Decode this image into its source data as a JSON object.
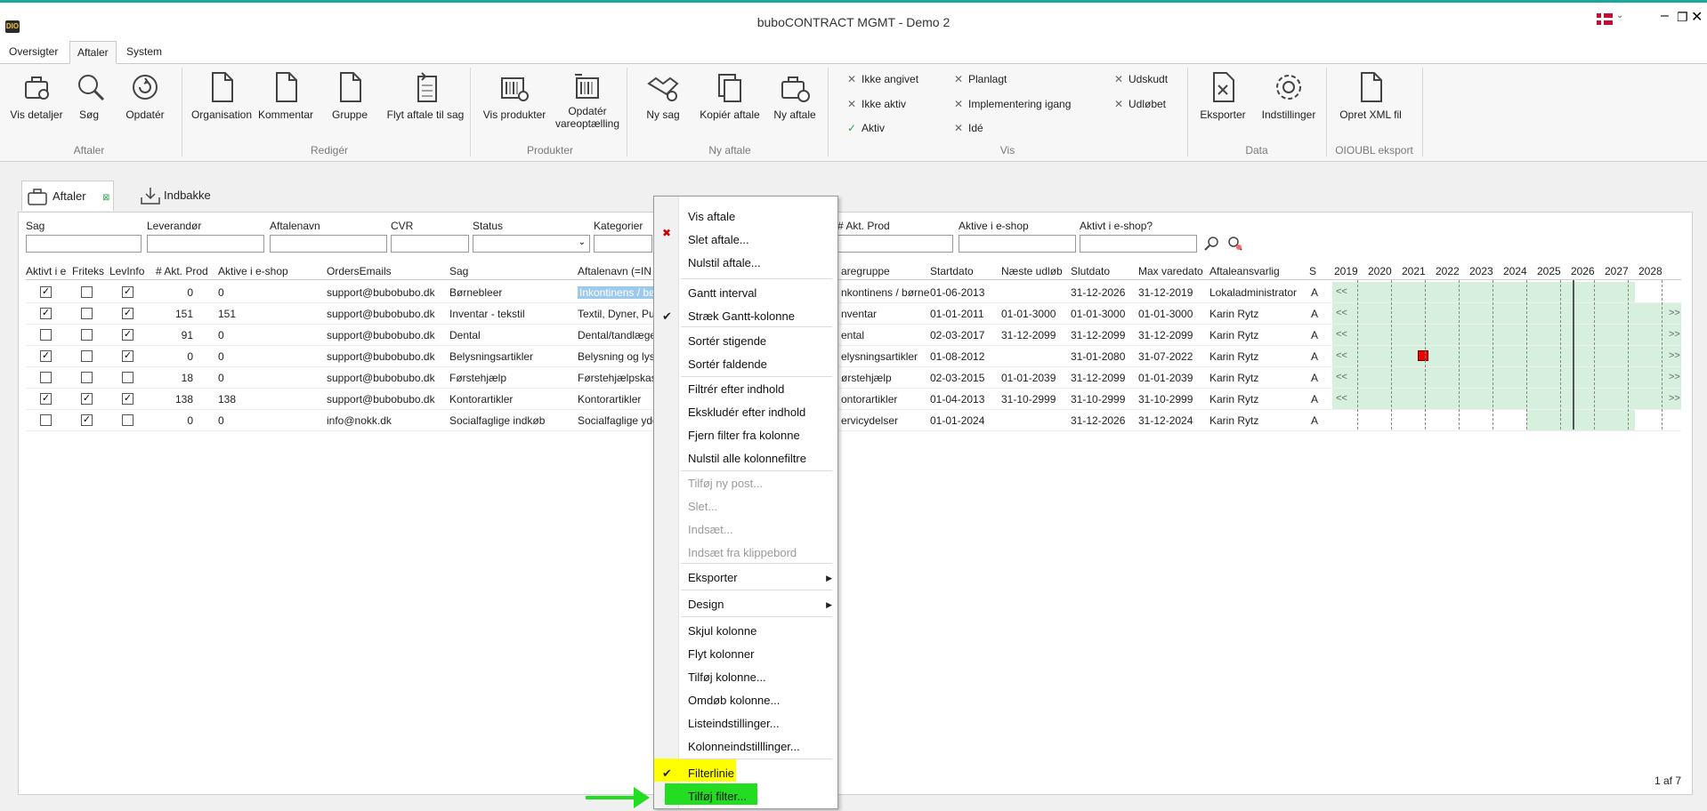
{
  "app": {
    "title": "buboCONTRACT MGMT - Demo 2",
    "logo": "DIO"
  },
  "menu_tabs": [
    "Oversigter",
    "Aftaler",
    "System"
  ],
  "ribbon": {
    "buttons": [
      {
        "label": "Vis detaljer",
        "icon": "briefcase-search-icon"
      },
      {
        "label": "Søg",
        "icon": "magnifier-icon"
      },
      {
        "label": "Opdatér",
        "icon": "refresh-icon"
      },
      {
        "label": "Organisation",
        "icon": "document-icon"
      },
      {
        "label": "Kommentar",
        "icon": "document-icon"
      },
      {
        "label": "Gruppe",
        "icon": "document-icon"
      },
      {
        "label": "Flyt aftale til sag",
        "icon": "move-document-icon"
      },
      {
        "label": "Vis produkter",
        "icon": "barcode-icon"
      },
      {
        "label": "Opdatér vareoptælling",
        "icon": "barcode-refresh-icon"
      },
      {
        "label": "Ny sag",
        "icon": "handshake-icon"
      },
      {
        "label": "Kopiér aftale",
        "icon": "copy-icon"
      },
      {
        "label": "Ny aftale",
        "icon": "briefcase-add-icon"
      },
      {
        "label": "Eksporter",
        "icon": "excel-export-icon"
      },
      {
        "label": "Indstillinger",
        "icon": "gear-icon"
      },
      {
        "label": "Opret XML fil",
        "icon": "document-icon"
      }
    ],
    "groups": [
      "Aftaler",
      "Redigér",
      "Produkter",
      "Ny aftale",
      "Vis",
      "Data",
      "OIOUBL eksport"
    ],
    "vis_items": [
      {
        "label": "Ikke angivet",
        "checked": false
      },
      {
        "label": "Ikke aktiv",
        "checked": false
      },
      {
        "label": "Aktiv",
        "checked": true
      },
      {
        "label": "Planlagt",
        "checked": false
      },
      {
        "label": "Implementering igang",
        "checked": false
      },
      {
        "label": "Idé",
        "checked": false
      },
      {
        "label": "Udskudt",
        "checked": false
      },
      {
        "label": "Udløbet",
        "checked": false
      }
    ]
  },
  "doc_tabs": [
    "Aftaler",
    "Indbakke"
  ],
  "filters": {
    "labels": [
      "Sag",
      "Leverandør",
      "Aftalenavn",
      "CVR",
      "Status",
      "Kategorier",
      "# Akt. Prod",
      "Aktive i e-shop",
      "Aktivt i e-shop?"
    ]
  },
  "grid": {
    "columns": [
      "Aktivt i e",
      "Friteks",
      "LevInfo",
      "# Akt. Prod",
      "Aktive i e-shop",
      "OrdersEmails",
      "Sag",
      "Aftalenavn (=IN",
      "aregruppe",
      "Startdato",
      "Næste udløb",
      "Slutdato",
      "Max varedato",
      "Aftaleansvarlig",
      "S"
    ],
    "years": [
      "2019",
      "2020",
      "2021",
      "2022",
      "2023",
      "2024",
      "2025",
      "2026",
      "2027",
      "2028"
    ],
    "rows": [
      {
        "aktivt": true,
        "friteks": false,
        "levinfo": true,
        "akt": "0",
        "eshop": "0",
        "email": "support@bubobubo.dk",
        "sag": "Børnebleer",
        "aftale": "Inkontinens / bø",
        "vare": "nkontinens / børnel",
        "start": "01-06-2013",
        "naeste": "",
        "slut": "31-12-2026",
        "max": "31-12-2019",
        "ansvarlig": "Lokaladministrator",
        "s": "A",
        "left": "<<",
        "right": ""
      },
      {
        "aktivt": true,
        "friteks": false,
        "levinfo": true,
        "akt": "151",
        "eshop": "151",
        "email": "support@bubobubo.dk",
        "sag": "Inventar - tekstil",
        "aftale": "Textil, Dyner, Pu",
        "vare": "nventar",
        "start": "01-01-2011",
        "naeste": "01-01-3000",
        "slut": "01-01-3000",
        "max": "01-01-3000",
        "ansvarlig": "Karin Rytz",
        "s": "A",
        "left": "<<",
        "right": ">>"
      },
      {
        "aktivt": false,
        "friteks": false,
        "levinfo": true,
        "akt": "91",
        "eshop": "0",
        "email": "support@bubobubo.dk",
        "sag": "Dental",
        "aftale": "Dental/tandlæge",
        "vare": "ental",
        "start": "02-03-2017",
        "naeste": "31-12-2099",
        "slut": "31-12-2099",
        "max": "31-12-2099",
        "ansvarlig": "Karin Rytz",
        "s": "A",
        "left": "<<",
        "right": ">>"
      },
      {
        "aktivt": true,
        "friteks": false,
        "levinfo": true,
        "akt": "0",
        "eshop": "0",
        "email": "support@bubobubo.dk",
        "sag": "Belysningsartikler",
        "aftale": "Belysning og lysk",
        "vare": "elysningsartikler",
        "start": "01-08-2012",
        "naeste": "",
        "slut": "31-01-2080",
        "max": "31-07-2022",
        "ansvarlig": "Karin Rytz",
        "s": "A",
        "left": "<<",
        "right": ">>"
      },
      {
        "aktivt": false,
        "friteks": false,
        "levinfo": false,
        "akt": "18",
        "eshop": "0",
        "email": "support@bubobubo.dk",
        "sag": "Førstehjælp",
        "aftale": "Førstehjælpskas",
        "vare": "ørstehjælp",
        "start": "02-03-2015",
        "naeste": "01-01-2039",
        "slut": "31-12-2099",
        "max": "01-01-2039",
        "ansvarlig": "Karin Rytz",
        "s": "A",
        "left": "<<",
        "right": ">>"
      },
      {
        "aktivt": true,
        "friteks": true,
        "levinfo": true,
        "akt": "138",
        "eshop": "138",
        "email": "support@bubobubo.dk",
        "sag": "Kontorartikler",
        "aftale": "Kontorartikler",
        "vare": "ontorartikler",
        "start": "01-04-2013",
        "naeste": "31-10-2999",
        "slut": "31-10-2999",
        "max": "31-10-2999",
        "ansvarlig": "Karin Rytz",
        "s": "A",
        "left": "<<",
        "right": ">>"
      },
      {
        "aktivt": false,
        "friteks": true,
        "levinfo": false,
        "akt": "0",
        "eshop": "0",
        "email": "info@nokk.dk",
        "sag": "Socialfaglige indkøb",
        "aftale": "Socialfaglige yde",
        "vare": "ervicydelser",
        "start": "01-01-2024",
        "naeste": "",
        "slut": "31-12-2026",
        "max": "31-12-2024",
        "ansvarlig": "Karin Rytz",
        "s": "A",
        "left": "",
        "right": ""
      }
    ],
    "pager": "1 af 7"
  },
  "context_menu": {
    "items": [
      {
        "label": "Vis aftale",
        "enabled": true
      },
      {
        "label": "Slet aftale...",
        "enabled": true
      },
      {
        "label": "Nulstil aftale...",
        "enabled": true
      },
      {
        "label": "Gantt interval",
        "enabled": true
      },
      {
        "label": "Stræk Gantt-kolonne",
        "enabled": true,
        "checked": true
      },
      {
        "label": "Sortér stigende",
        "enabled": true
      },
      {
        "label": "Sortér faldende",
        "enabled": true
      },
      {
        "label": "Filtrér efter indhold",
        "enabled": true
      },
      {
        "label": "Ekskludér efter indhold",
        "enabled": true
      },
      {
        "label": "Fjern filter fra kolonne",
        "enabled": true
      },
      {
        "label": "Nulstil alle kolonnefiltre",
        "enabled": true
      },
      {
        "label": "Tilføj ny post...",
        "enabled": false
      },
      {
        "label": "Slet...",
        "enabled": false
      },
      {
        "label": "Indsæt...",
        "enabled": false
      },
      {
        "label": "Indsæt fra klippebord",
        "enabled": false
      },
      {
        "label": "Eksporter",
        "enabled": true,
        "submenu": true
      },
      {
        "label": "Design",
        "enabled": true,
        "submenu": true
      },
      {
        "label": "Skjul kolonne",
        "enabled": true
      },
      {
        "label": "Flyt kolonner",
        "enabled": true
      },
      {
        "label": "Tilføj kolonne...",
        "enabled": true
      },
      {
        "label": "Omdøb kolonne...",
        "enabled": true
      },
      {
        "label": "Listeindstillinger...",
        "enabled": true
      },
      {
        "label": "Kolonneindstilllinger...",
        "enabled": true
      },
      {
        "label": "Filterlinie",
        "enabled": true,
        "checked": true
      },
      {
        "label": "Tilføj filter...",
        "enabled": true
      }
    ]
  },
  "colors": {
    "accent": "#1aa89a",
    "gantt": "#d6f0dd",
    "highlight_yellow": "#ffff00",
    "highlight_green": "#22dd22",
    "selected_cell": "#9cc9ec"
  }
}
